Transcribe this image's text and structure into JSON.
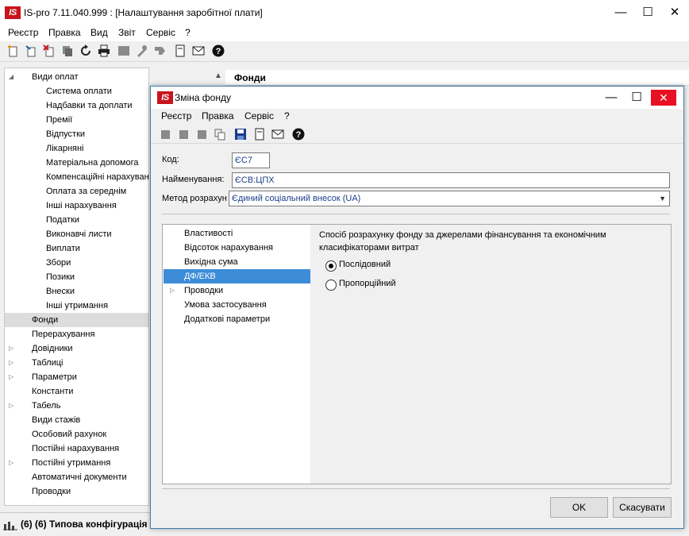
{
  "main": {
    "title": "IS-pro 7.11.040.999 : [Налаштування заробітної плати]",
    "logo": "IS",
    "window_controls": {
      "minimize": "—",
      "maximize": "☐",
      "close": "✕"
    },
    "menu": [
      "Реєстр",
      "Правка",
      "Вид",
      "Звіт",
      "Сервіс",
      "?"
    ],
    "toolbar_icons": [
      "new-document-icon",
      "add-child-icon",
      "delete-icon",
      "copy-icon",
      "duplicate-icon",
      "refresh-icon",
      "print-icon",
      "disabled-icon",
      "tools-icon",
      "export-icon",
      "view-icon",
      "mail-icon",
      "help-icon"
    ]
  },
  "tree": {
    "items": [
      {
        "label": "Види оплат",
        "level": 0,
        "arrow": "◢"
      },
      {
        "label": "Система оплати",
        "level": 1
      },
      {
        "label": "Надбавки та доплати",
        "level": 1
      },
      {
        "label": "Премії",
        "level": 1
      },
      {
        "label": "Відпустки",
        "level": 1
      },
      {
        "label": "Лікарняні",
        "level": 1
      },
      {
        "label": "Матеріальна допомога",
        "level": 1
      },
      {
        "label": "Компенсаційні нарахування",
        "level": 1
      },
      {
        "label": "Оплата за середнім",
        "level": 1
      },
      {
        "label": "Інші нарахування",
        "level": 1
      },
      {
        "label": "Податки",
        "level": 1
      },
      {
        "label": "Виконавчі листи",
        "level": 1
      },
      {
        "label": "Виплати",
        "level": 1
      },
      {
        "label": "Збори",
        "level": 1
      },
      {
        "label": "Позики",
        "level": 1
      },
      {
        "label": "Внески",
        "level": 1
      },
      {
        "label": "Інші утримання",
        "level": 1
      },
      {
        "label": "Фонди",
        "level": 0,
        "selected": true
      },
      {
        "label": "Перерахування",
        "level": 0
      },
      {
        "label": "Довідники",
        "level": 0,
        "arrow": "▷"
      },
      {
        "label": "Таблиці",
        "level": 0,
        "arrow": "▷"
      },
      {
        "label": "Параметри",
        "level": 0,
        "arrow": "▷"
      },
      {
        "label": "Константи",
        "level": 0
      },
      {
        "label": "Табель",
        "level": 0,
        "arrow": "▷"
      },
      {
        "label": "Види стажів",
        "level": 0
      },
      {
        "label": "Особовий рахунок",
        "level": 0
      },
      {
        "label": "Постійні нарахування",
        "level": 0
      },
      {
        "label": "Постійні утримання",
        "level": 0,
        "arrow": "▷"
      },
      {
        "label": "Автоматичні документи",
        "level": 0
      },
      {
        "label": "Проводки",
        "level": 0
      }
    ]
  },
  "right_header": {
    "title": "Фонди",
    "collapse_glyph": "▲"
  },
  "status": {
    "text": "(6) (6) Типова конфігурація"
  },
  "dialog": {
    "title": "Зміна фонду",
    "logo": "IS",
    "controls": {
      "minimize": "—",
      "maximize": "☐",
      "close": "✕"
    },
    "menu": [
      "Реєстр",
      "Правка",
      "Сервіс",
      "?"
    ],
    "toolbar_icons": [
      "add-icon",
      "edit-icon",
      "delete-icon",
      "copy-icon",
      "save-icon",
      "view-icon",
      "mail-icon",
      "help-icon"
    ],
    "code_label": "Код:",
    "code_value": "ЄС7",
    "name_label": "Найменування:",
    "name_value": "ЄСВ:ЦПХ",
    "method_label": "Метод розрахун",
    "method_value": "Єдиний соціальний внесок (UA)",
    "sections": [
      {
        "label": "Властивості"
      },
      {
        "label": "Відсоток нарахування"
      },
      {
        "label": "Вихідна сума"
      },
      {
        "label": "ДФ/ЕКВ",
        "selected": true
      },
      {
        "label": "Проводки",
        "arrow": "▷"
      },
      {
        "label": "Умова застосування"
      },
      {
        "label": "Додаткові параметри"
      }
    ],
    "calc_description": "Спосіб розрахунку фонду за джерелами фінансування та економічним класифікаторами витрат",
    "radio_options": [
      {
        "label": "Послідовний",
        "checked": true
      },
      {
        "label": "Пропорційний",
        "checked": false
      }
    ],
    "ok_label": "OK",
    "cancel_label": "Скасувати"
  },
  "colors": {
    "accent_selection": "#3c8cd8",
    "close_red": "#e81123",
    "logo_red": "#c8141c",
    "value_blue": "#1a3c8c"
  }
}
